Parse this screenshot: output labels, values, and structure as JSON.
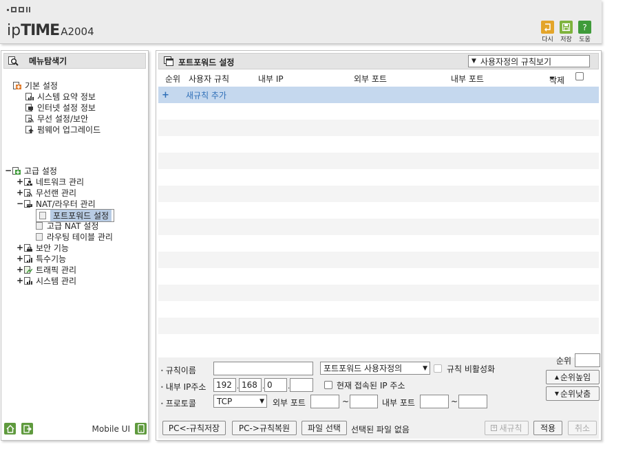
{
  "header": {
    "brand_prefix": "ip",
    "brand_main": "TIME",
    "model": "A2004",
    "buttons": [
      {
        "label": "다시",
        "icon": "refresh-icon",
        "color": "#e3a52a"
      },
      {
        "label": "저장",
        "icon": "save-icon",
        "color": "#7eb33c"
      },
      {
        "label": "도움",
        "icon": "help-icon",
        "color": "#3f9b3a"
      }
    ]
  },
  "sidebar": {
    "title": "메뉴탐색기",
    "basic": {
      "label": "기본 설정",
      "items": [
        "시스템 요약 정보",
        "인터넷 설정 정보",
        "무선 설정/보안",
        "펌웨어 업그레이드"
      ]
    },
    "advanced": {
      "label": "고급 설정",
      "items": [
        {
          "label": "네트워크 관리",
          "expand": "+"
        },
        {
          "label": "무선랜 관리",
          "expand": "+"
        },
        {
          "label": "NAT/라우터 관리",
          "expand": "−"
        },
        {
          "label": "포트포워드 설정",
          "child": true,
          "selected": true
        },
        {
          "label": "고급 NAT 설정",
          "child": true
        },
        {
          "label": "라우팅 테이블 관리",
          "child": true
        },
        {
          "label": "보안 기능",
          "expand": "+"
        },
        {
          "label": "특수기능",
          "expand": "+"
        },
        {
          "label": "트래픽 관리",
          "expand": "+"
        },
        {
          "label": "시스템 관리",
          "expand": "+"
        }
      ]
    },
    "footer": {
      "mobile_label": "Mobile UI"
    }
  },
  "panel": {
    "title": "포트포워드 설정",
    "view_select": "사용자정의 규칙보기",
    "columns": {
      "order": "순위",
      "rule": "사용자 규칙",
      "internal_ip": "내부 IP",
      "external_port": "외부 포트",
      "internal_port": "내부 포트",
      "delete": "삭제"
    },
    "add_rule_label": "새규칙 추가",
    "form": {
      "rule_name_label": "규칙이름",
      "rule_name_value": "",
      "rule_type_select": "포트포워드 사용자정의",
      "disable_rule_label": "규칙 비활성화",
      "internal_ip_label": "내부 IP주소",
      "ip": [
        "192",
        "168",
        "0",
        ""
      ],
      "current_ip_label": "현재 접속된 IP 주소",
      "protocol_label": "프로토콜",
      "protocol_value": "TCP",
      "external_port_label": "외부 포트",
      "internal_port_label": "내부 포트",
      "tilde": "~",
      "order_label": "순위",
      "order_up": "순위높임",
      "order_down": "순위낮춤"
    },
    "buttons": {
      "save_to_pc": "PC<-규칙저장",
      "restore_from_pc": "PC->규칙복원",
      "choose_file": "파일 선택",
      "no_file": "선택된 파일 없음",
      "new_rule": "새규칙",
      "apply": "적용",
      "cancel": "취소"
    }
  }
}
